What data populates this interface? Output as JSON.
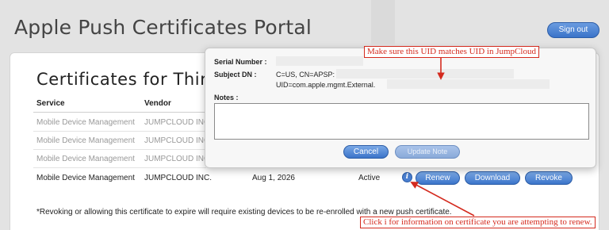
{
  "header": {
    "title": "Apple Push Certificates Portal",
    "sign_out": "Sign out"
  },
  "section": {
    "title": "Certificates for Third-Pa"
  },
  "table": {
    "columns": [
      "Service",
      "Vendor"
    ],
    "rows": [
      {
        "service": "Mobile Device Management",
        "vendor": "JUMPCLOUD INC."
      },
      {
        "service": "Mobile Device Management",
        "vendor": "JUMPCLOUD INC."
      },
      {
        "service": "Mobile Device Management",
        "vendor": "JUMPCLOUD INC."
      },
      {
        "service": "Mobile Device Management",
        "vendor": "JUMPCLOUD INC.",
        "expiration": "Aug 1, 2026",
        "status": "Active"
      }
    ],
    "actions": {
      "renew": "Renew",
      "download": "Download",
      "revoke": "Revoke"
    },
    "info_glyph": "i"
  },
  "footnote": "*Revoking or allowing this certificate to expire will require existing devices to be re-enrolled with a new push certificate.",
  "popover": {
    "serial_label": "Serial Number :",
    "subject_label": "Subject DN :",
    "subject_line1": "C=US, CN=APSP:",
    "subject_line2": "UID=com.apple.mgmt.External.",
    "notes_label": "Notes :",
    "notes_value": "",
    "cancel": "Cancel",
    "update_note": "Update Note"
  },
  "annotations": {
    "uid_callout": "Make sure this UID matches UID in JumpCloud",
    "info_callout": "Click i for information on certificate you are attempting to renew."
  },
  "colors": {
    "annotation_red": "#d42a1e",
    "button_blue": "#3b74c9"
  }
}
